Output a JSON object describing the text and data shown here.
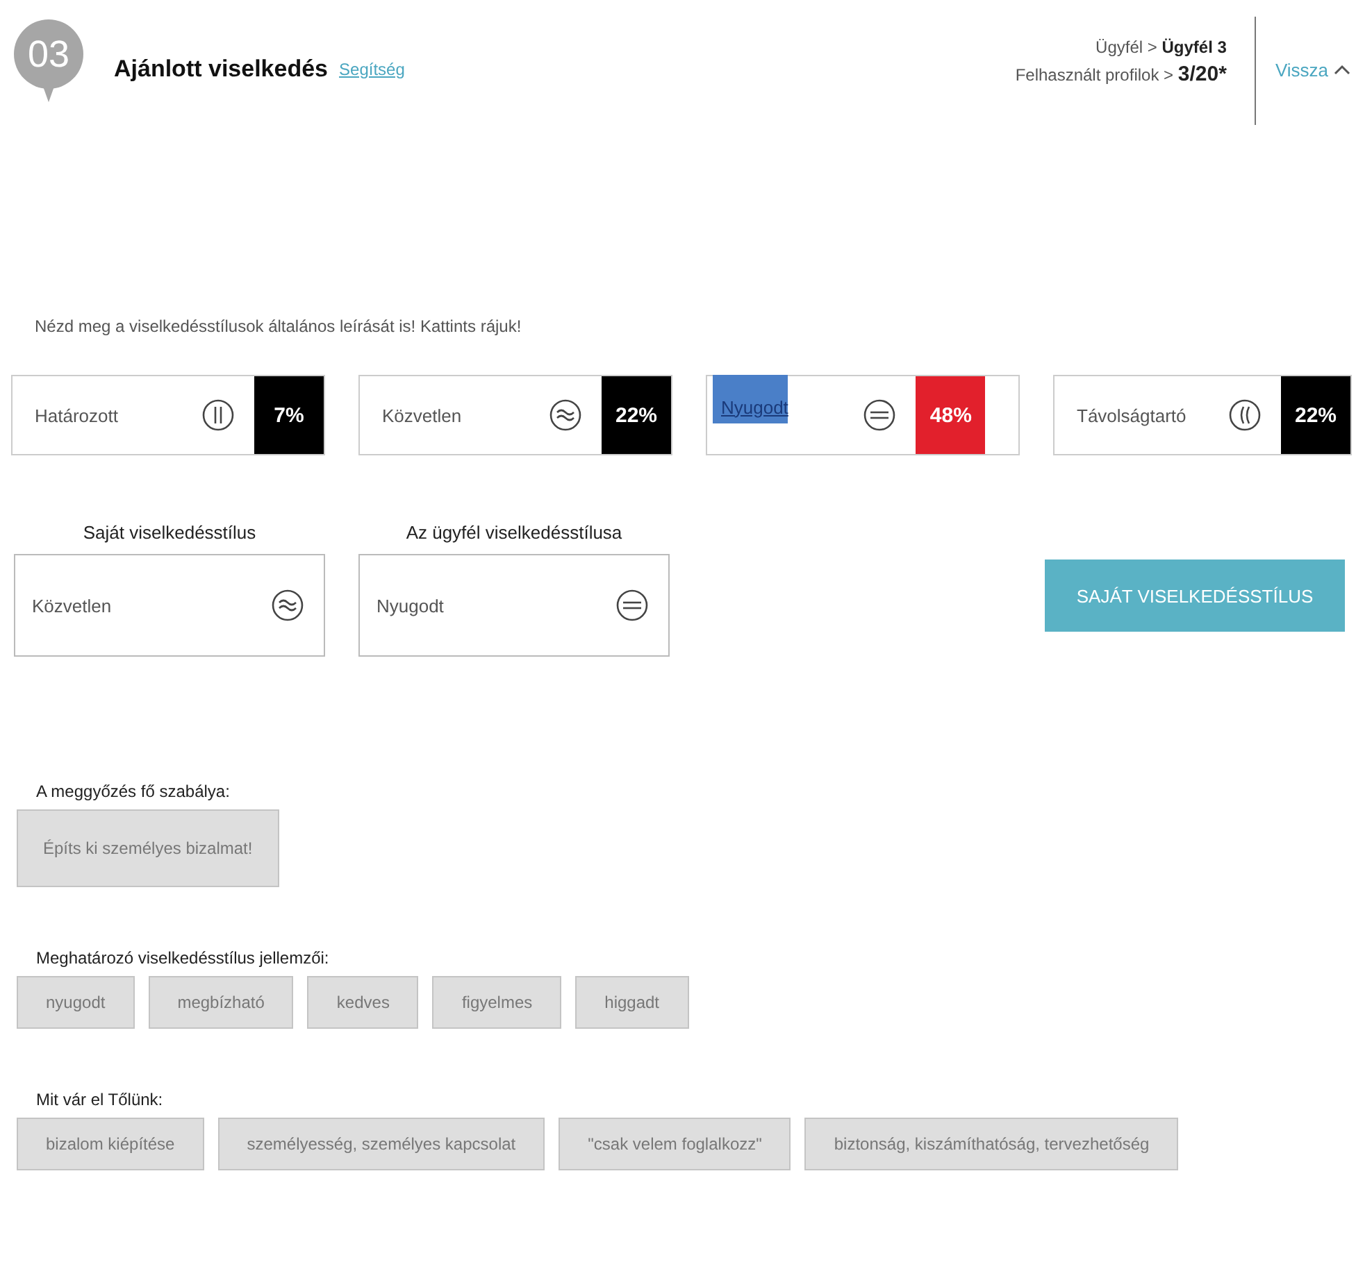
{
  "header": {
    "step": "03",
    "title": "Ajánlott viselkedés",
    "help_link": "Segítség",
    "breadcrumb": {
      "label": "Ügyfél >",
      "value": "Ügyfél 3"
    },
    "profiles": {
      "label": "Felhasznált profilok >",
      "value": "3/20*"
    },
    "back": "Vissza"
  },
  "intro": "Nézd meg a viselkedésstílusok általános leírását is! Kattints rájuk!",
  "styles": [
    {
      "name": "Határozott",
      "kind": "parallel",
      "percent": "7%",
      "color": "#000000",
      "highlighted": false
    },
    {
      "name": "Közvetlen",
      "kind": "wave",
      "percent": "22%",
      "color": "#000000",
      "highlighted": false
    },
    {
      "name": "Nyugodt",
      "kind": "equal",
      "percent": "48%",
      "color": "#e2202c",
      "highlighted": true
    },
    {
      "name": "Távolságtartó",
      "kind": "curve",
      "percent": "22%",
      "color": "#000000",
      "highlighted": false
    }
  ],
  "own_style": {
    "label": "Saját viselkedésstílus",
    "name": "Közvetlen",
    "kind": "wave"
  },
  "client_style": {
    "label": "Az ügyfél viselkedésstílusa",
    "name": "Nyugodt",
    "kind": "equal"
  },
  "own_style_button": "SAJÁT VISELKEDÉSSTÍLUS",
  "sections": [
    {
      "label": "A meggyőzés fő szabálya:",
      "chips": [
        "Építs ki személyes bizalmat!"
      ]
    },
    {
      "label": "Meghatározó viselkedésstílus jellemzői:",
      "chips": [
        "nyugodt",
        "megbízható",
        "kedves",
        "figyelmes",
        "higgadt"
      ]
    },
    {
      "label": "Mit vár el Tőlünk:",
      "chips": [
        "bizalom kiépítése",
        "személyesség, személyes kapcsolat",
        "\"csak velem foglalkozz\"",
        "biztonság, kiszámíthatóság, tervezhetőség"
      ]
    }
  ]
}
